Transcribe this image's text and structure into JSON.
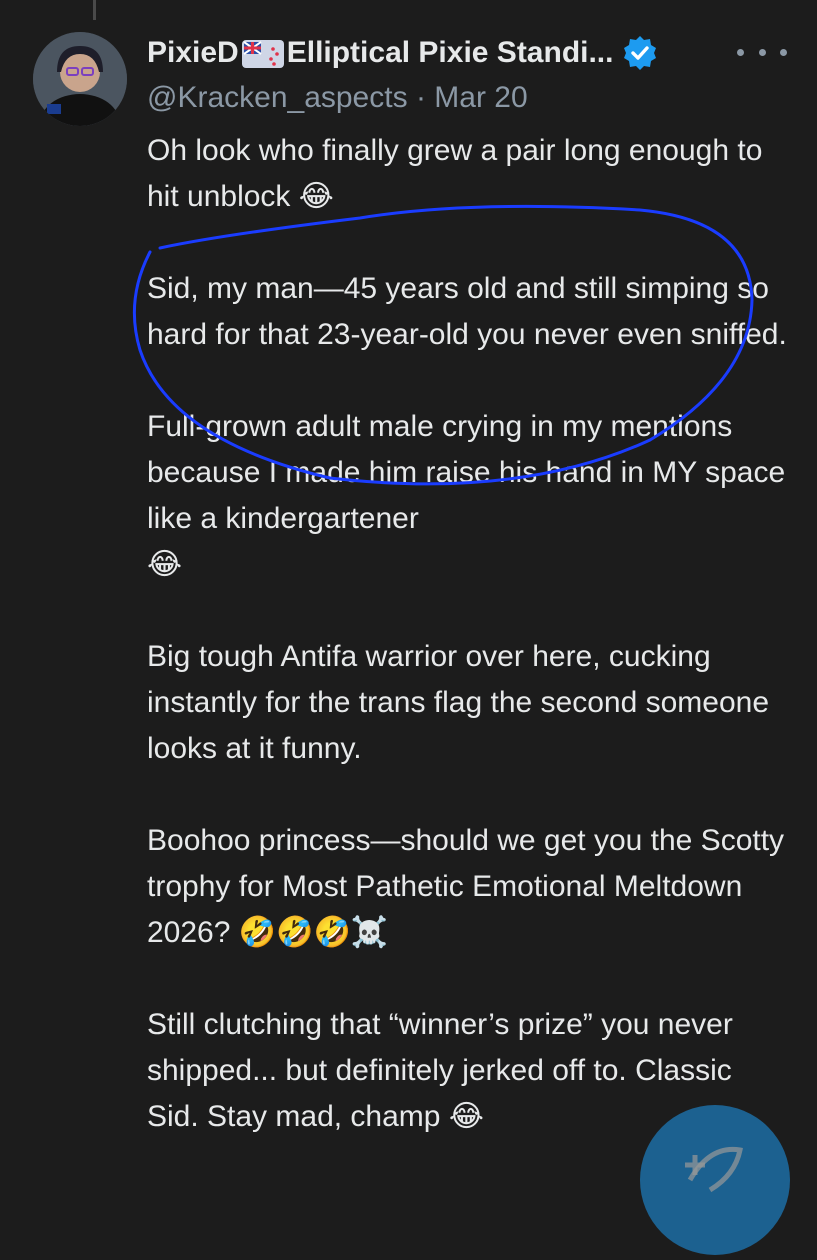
{
  "post": {
    "display_name_start": "PixieD",
    "display_name_end": "Elliptical Pixie Standi...",
    "handle": "@Kracken_aspects",
    "separator": "·",
    "date": "Mar 20",
    "flag_icon": "new-zealand-flag-icon",
    "verified_icon": "verified-badge-icon",
    "more_icon": "more-options-icon",
    "paragraphs": [
      {
        "text": "Oh look who finally grew a pair long enough to hit unblock",
        "emoji": "😂"
      },
      {
        "text": "Sid, my man—45 years old and still simping so hard for that 23-year-old you never even sniffed.",
        "emoji": ""
      },
      {
        "text": "Full-grown adult male crying in my mentions because I made him raise his hand in MY space like a kindergartener",
        "emoji": "😂"
      },
      {
        "text": "Big tough Antifa warrior over here, cucking instantly for the trans flag the second someone looks at it funny.",
        "emoji": ""
      },
      {
        "text": "Boohoo princess—should we get you the Scotty trophy for Most Pathetic Emotional Meltdown 2026?",
        "emoji": "🤣🤣🤣☠️"
      },
      {
        "text": "Still clutching that “winner’s prize” you never shipped... but definitely jerked off to. Classic Sid. Stay mad, champ",
        "emoji": "😂"
      }
    ]
  },
  "colors": {
    "background": "#1c1c1c",
    "text": "#e7e9ea",
    "muted": "#8b98a5",
    "accent": "#1d9bf0",
    "annotation": "#1a3cff"
  },
  "floating_button_icon": "compose-post-icon"
}
